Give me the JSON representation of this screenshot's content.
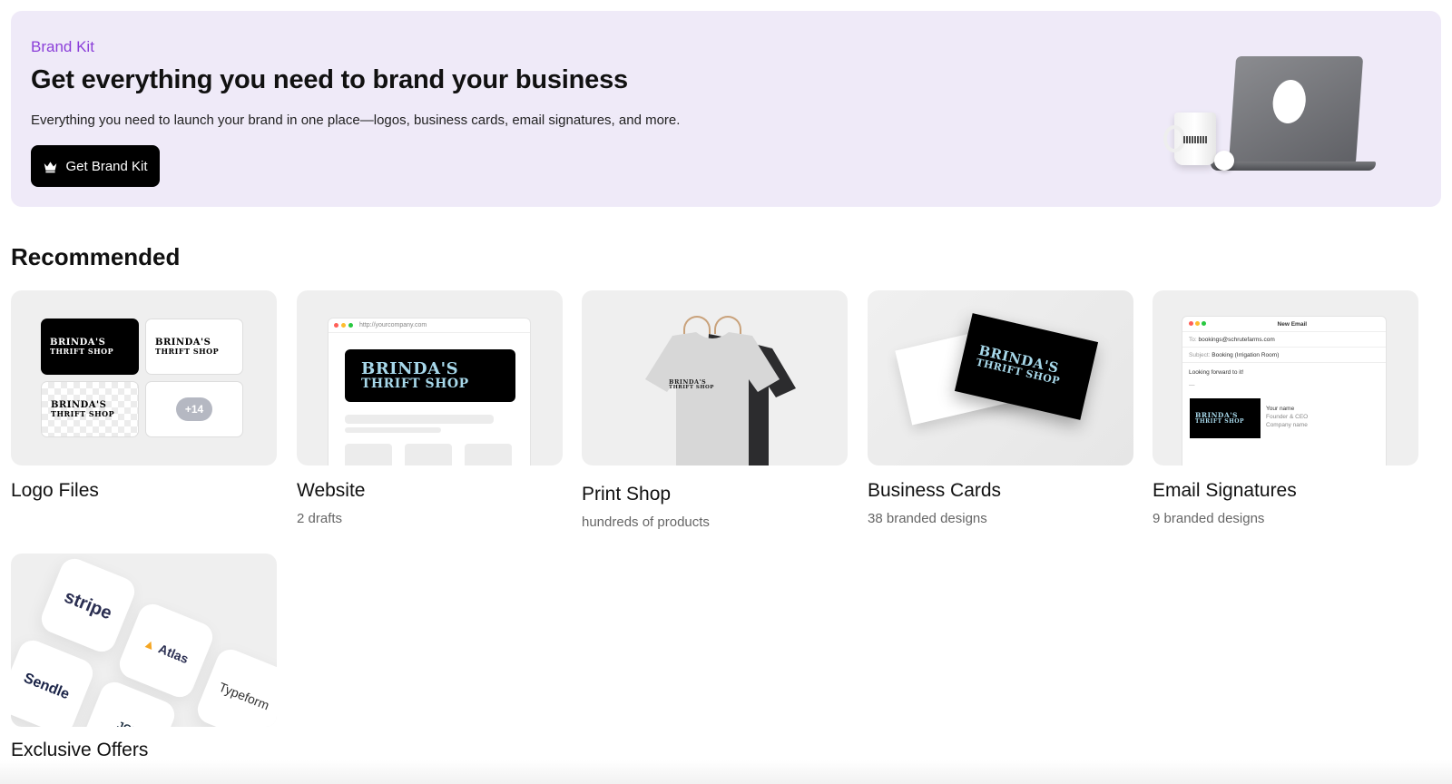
{
  "banner": {
    "eyebrow": "Brand Kit",
    "title": "Get everything you need to brand your business",
    "description": "Everything you need to launch your brand in one place—logos, business cards, email signatures, and more.",
    "cta_label": "Get Brand Kit",
    "cta_icon": "crown-icon"
  },
  "brand": {
    "name_line1": "BRINDA'S",
    "name_line2": "THRIFT SHOP"
  },
  "section": {
    "title": "Recommended"
  },
  "cards": [
    {
      "title": "Logo Files",
      "subtitle": "",
      "extra": "+14"
    },
    {
      "title": "Website",
      "subtitle": "2 drafts",
      "url": "http://yourcompany.com"
    },
    {
      "title": "Print Shop",
      "subtitle": "hundreds of products"
    },
    {
      "title": "Business Cards",
      "subtitle": "38 branded designs"
    },
    {
      "title": "Email Signatures",
      "subtitle": "9 branded designs",
      "email": {
        "heading": "New Email",
        "to": "bookings@schrutefarms.com",
        "subject": "Booking (Irrigation Room)",
        "body": "Looking forward to it!",
        "sig_dash": "—",
        "sig_name": "Your name",
        "sig_title": "Founder & CEO",
        "sig_company": "Company name"
      }
    },
    {
      "title": "Exclusive Offers",
      "subtitle": "",
      "partners": [
        "stripe",
        "Atlas",
        "Sendle",
        "Typeform",
        "JOB"
      ]
    }
  ],
  "colors": {
    "accent": "#8b3fd9",
    "banner_bg": "#efeaf8",
    "brand_mint": "#a7d8ea",
    "brand_purple": "#b9a2f0"
  }
}
